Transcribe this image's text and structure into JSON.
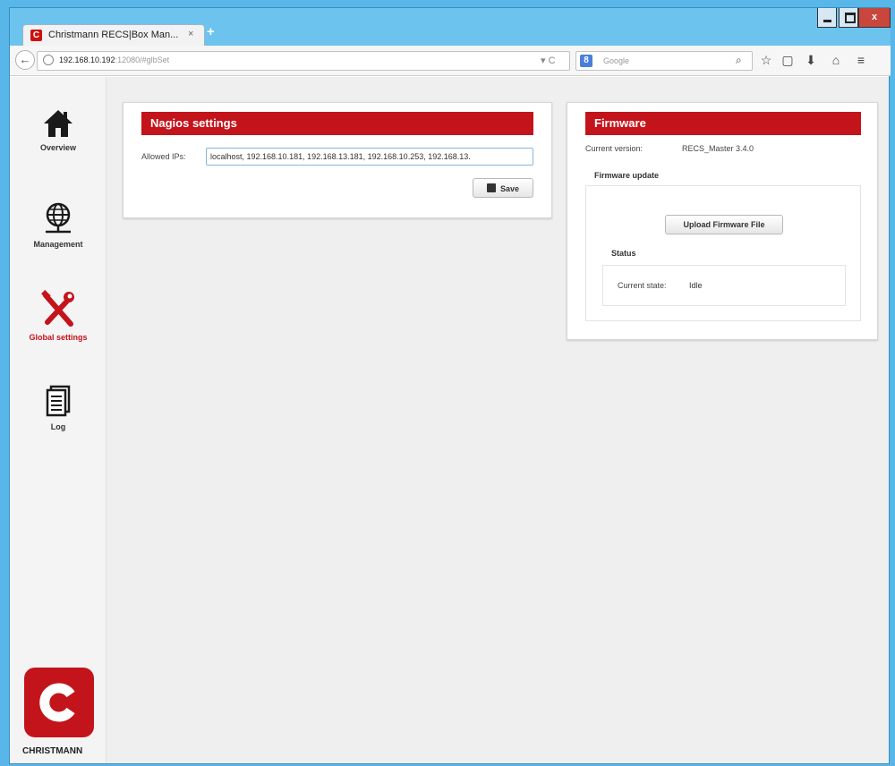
{
  "browser": {
    "tab_title": "Christmann RECS|Box Man...",
    "tab_close": "×",
    "new_tab": "+",
    "url_host": "192.168.10.192",
    "url_rest": ":12080/#glbSet",
    "url_reload": "▾ C",
    "search_engine_badge": "8",
    "search_placeholder": "Google",
    "close_glyph": "x"
  },
  "sidebar": {
    "items": [
      {
        "label": "Overview",
        "icon": "home-icon"
      },
      {
        "label": "Management",
        "icon": "globe-network-icon"
      },
      {
        "label": "Global settings",
        "icon": "wrench-screwdriver-icon"
      },
      {
        "label": "Log",
        "icon": "document-stack-icon"
      }
    ],
    "brand_letter": "C",
    "brand_name": "CHRISTMANN"
  },
  "nagios": {
    "title": "Nagios settings",
    "allowed_ips_label": "Allowed IPs:",
    "allowed_ips_value": "localhost, 192.168.10.181, 192.168.13.181, 192.168.10.253, 192.168.13.",
    "save_label": "Save"
  },
  "firmware": {
    "title": "Firmware",
    "current_version_label": "Current version:",
    "current_version_value": "RECS_Master 3.4.0",
    "update_label": "Firmware update",
    "upload_label": "Upload Firmware File",
    "status_title": "Status",
    "current_state_label": "Current state:",
    "current_state_value": "Idle"
  },
  "colors": {
    "accent_red": "#c4141b",
    "titlebar_blue": "#6cc3ee"
  }
}
